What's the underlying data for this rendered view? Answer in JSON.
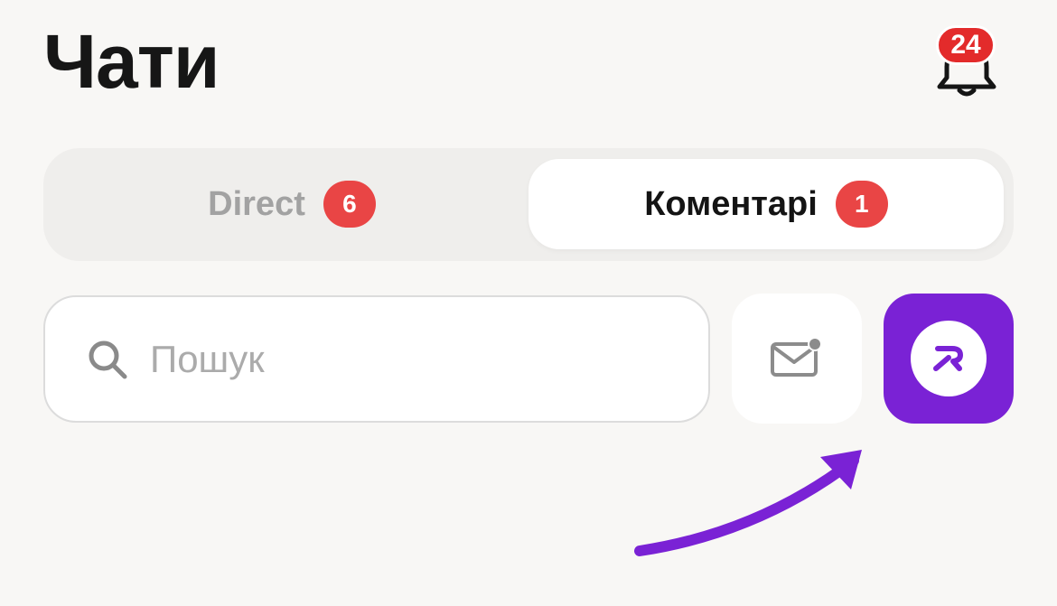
{
  "header": {
    "title": "Чати",
    "notifications": {
      "count": "24",
      "icon": "bell-icon",
      "badge_color": "#e32b2b"
    }
  },
  "tabs": [
    {
      "label": "Direct",
      "count": "6",
      "active": false
    },
    {
      "label": "Коментарі",
      "count": "1",
      "active": true
    }
  ],
  "search": {
    "placeholder": "Пошук",
    "value": "",
    "icon": "search-icon"
  },
  "actions": {
    "mail_icon": "mail-unread-icon",
    "brand_icon": "brand-logo-icon",
    "brand_color": "#7a22d5"
  },
  "annotation": {
    "icon": "pointer-arrow-icon",
    "color": "#7a22d5"
  }
}
